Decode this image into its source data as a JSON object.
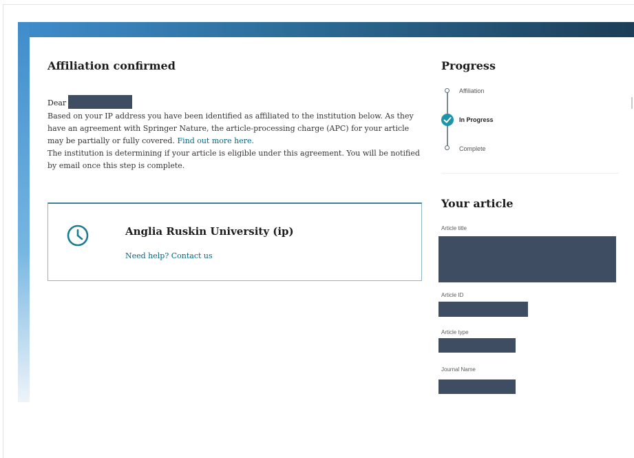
{
  "affiliation": {
    "title": "Affiliation confirmed",
    "greeting": "Dear",
    "paragraph_1": "Based on your IP address you have been identified as affiliated to the institution below. As they have an agreement with Springer Nature, the article-processing charge (APC) for your article may be partially or fully covered.",
    "find_out_more": "Find out more here.",
    "paragraph_2": "The institution is determining if your article is eligible under this agreement. You will be notified by email once this step is complete."
  },
  "institution": {
    "name": "Anglia Ruskin University (ip)",
    "help_link": "Need help? Contact us",
    "icon": "clock-icon"
  },
  "progress": {
    "title": "Progress",
    "steps": [
      {
        "label": "Affiliation",
        "state": "done"
      },
      {
        "label": "In Progress",
        "state": "active"
      },
      {
        "label": "Complete",
        "state": "pending"
      }
    ]
  },
  "article": {
    "heading": "Your article",
    "fields": [
      {
        "label": "Article title"
      },
      {
        "label": "Article ID"
      },
      {
        "label": "Article type"
      },
      {
        "label": "Journal Name"
      }
    ]
  },
  "colors": {
    "accent": "#1b96a8",
    "link": "#006685",
    "redaction": "#3f4d62",
    "header_bar_start": "#3f8ccb",
    "header_bar_end": "#1c3e58"
  }
}
